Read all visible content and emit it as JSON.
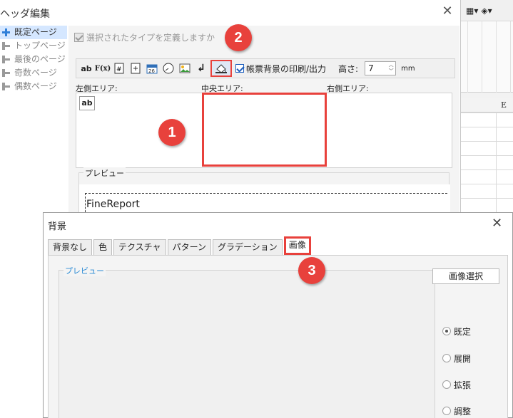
{
  "header_dialog": {
    "title": "ヘッダ編集",
    "tree_items": [
      {
        "label": "既定ページ"
      },
      {
        "label": "トップページ"
      },
      {
        "label": "最後のページ"
      },
      {
        "label": "奇数ページ"
      },
      {
        "label": "偶数ページ"
      }
    ],
    "define_type_checkbox": "選択されたタイプを定義しますか",
    "toolbar": {
      "text_btn": "ab",
      "formula_btn": "F(x)",
      "print_background_label": "帳票背景の印刷/出力",
      "height_label": "高さ:",
      "height_value": "7",
      "height_unit": "mm"
    },
    "areas": {
      "left": "左側エリア:",
      "center": "中央エリア:",
      "right": "右側エリア:",
      "left_button": "ab"
    },
    "preview": {
      "legend": "プレビュー",
      "sample_text": "FineReport"
    }
  },
  "background_dialog": {
    "title": "背景",
    "tabs": [
      "背景なし",
      "色",
      "テクスチャ",
      "パターン",
      "グラデーション",
      "画像"
    ],
    "active_tab": "画像",
    "preview_legend": "プレビュー",
    "select_image_button": "画像選択",
    "layout_options": [
      "既定",
      "展開",
      "拡張",
      "調整"
    ],
    "selected_layout": "既定"
  },
  "sheet": {
    "column_header": "E"
  },
  "callouts": [
    "1",
    "2",
    "3"
  ],
  "colors": {
    "highlight": "#e8413c",
    "selection": "#d5e7ff",
    "accent": "#1d5fbd"
  }
}
